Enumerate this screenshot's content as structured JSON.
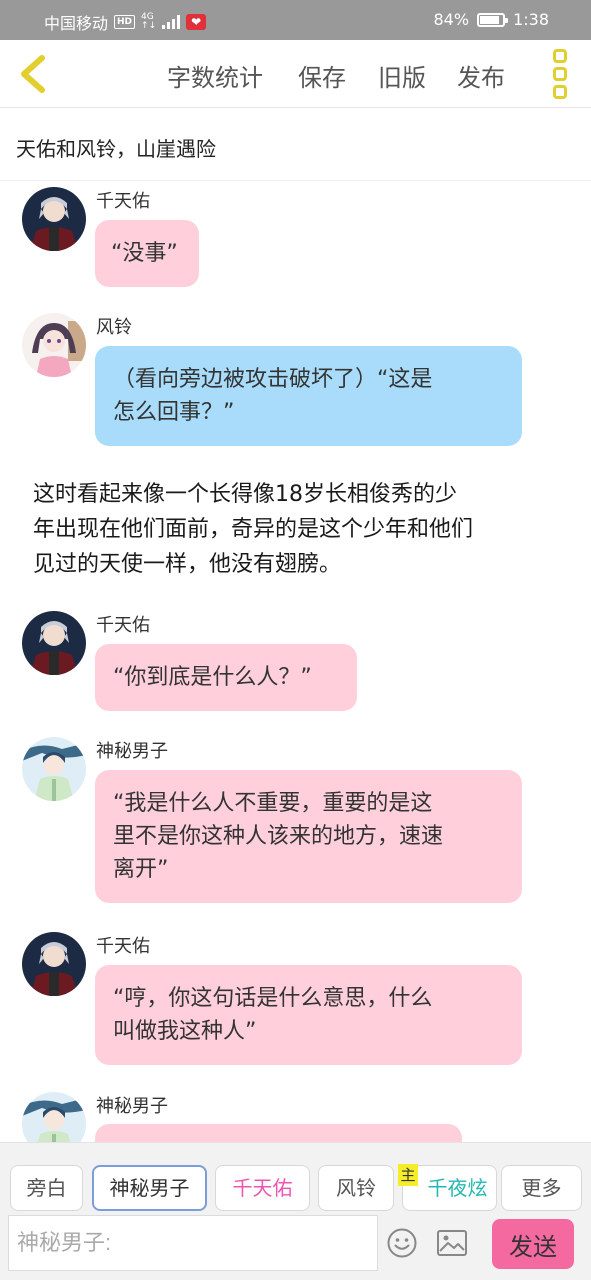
{
  "status_bar": {
    "carrier": "中国移动",
    "hd": "HD",
    "network": "4G",
    "battery_percent": "84%",
    "battery_level": 0.84,
    "time": "1:38"
  },
  "toolbar": {
    "back_icon": "chevron-left-icon",
    "word_count": "字数统计",
    "save": "保存",
    "old_version": "旧版",
    "publish": "发布",
    "more_icon": "vertical-dots-icon"
  },
  "chapter_title": "天佑和风铃，山崖遇险",
  "messages": [
    {
      "speaker": "千天佑",
      "text": "“没事”",
      "color": "#ffd0dc"
    },
    {
      "speaker": "风铃",
      "lines": [
        "（看向旁边被攻击破坏了）“这是",
        "怎么回事？”"
      ],
      "color": "#a8dcfa"
    },
    {
      "narration": [
        "这时看起来像一个长得像18岁长相俊秀的少",
        "年出现在他们面前，奇异的是这个少年和他们",
        "见过的天使一样，他没有翅膀。"
      ]
    },
    {
      "speaker": "千天佑",
      "text": "“你到底是什么人？”",
      "color": "#ffd0dc"
    },
    {
      "speaker": "神秘男子",
      "lines": [
        "“我是什么人不重要，重要的是这",
        "里不是你这种人该来的地方，速速",
        "离开”"
      ],
      "color": "#ffd0dc"
    },
    {
      "speaker": "千天佑",
      "lines": [
        "“哼，你这句话是什么意思，什么",
        "叫做我这种人”"
      ],
      "color": "#ffd0dc"
    },
    {
      "speaker": "神秘男子",
      "text": "",
      "color": "#ffd0dc"
    }
  ],
  "roles": {
    "narrator": "旁白",
    "mystery_man": "神秘男子",
    "tianyou": "千天佑",
    "fengling": "风铃",
    "host_tag": "主",
    "qianyexuan": "千夜炫",
    "more": "更多"
  },
  "composer": {
    "placeholder": "神秘男子:",
    "emoji_icon": "smiley-icon",
    "image_icon": "image-icon",
    "send": "发送"
  },
  "colors": {
    "pink_bubble": "#ffd0dc",
    "blue_bubble": "#a8dcfa",
    "accent_yellow": "#e2cf2f",
    "send_button": "#f46aa0"
  }
}
